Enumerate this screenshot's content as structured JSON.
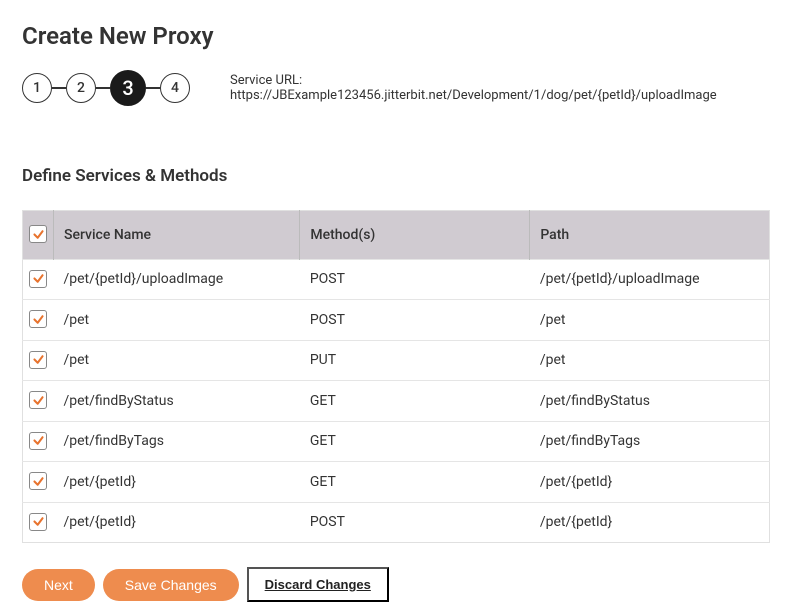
{
  "pageTitle": "Create New Proxy",
  "stepper": {
    "steps": [
      "1",
      "2",
      "3",
      "4"
    ],
    "activeIndex": 2
  },
  "serviceUrlLabel": "Service URL:",
  "serviceUrl": "https://JBExample123456.jitterbit.net/Development/1/dog/pet/{petId}/uploadImage",
  "sectionTitle": "Define Services & Methods",
  "table": {
    "headers": [
      "Service Name",
      "Method(s)",
      "Path"
    ],
    "rows": [
      {
        "checked": true,
        "serviceName": "/pet/{petId}/uploadImage",
        "method": "POST",
        "path": "/pet/{petId}/uploadImage"
      },
      {
        "checked": true,
        "serviceName": "/pet",
        "method": "POST",
        "path": "/pet"
      },
      {
        "checked": true,
        "serviceName": "/pet",
        "method": "PUT",
        "path": "/pet"
      },
      {
        "checked": true,
        "serviceName": "/pet/findByStatus",
        "method": "GET",
        "path": "/pet/findByStatus"
      },
      {
        "checked": true,
        "serviceName": "/pet/findByTags",
        "method": "GET",
        "path": "/pet/findByTags"
      },
      {
        "checked": true,
        "serviceName": "/pet/{petId}",
        "method": "GET",
        "path": "/pet/{petId}"
      },
      {
        "checked": true,
        "serviceName": "/pet/{petId}",
        "method": "POST",
        "path": "/pet/{petId}"
      }
    ]
  },
  "buttons": {
    "next": "Next",
    "saveChanges": "Save Changes",
    "discardChanges": "Discard Changes"
  }
}
